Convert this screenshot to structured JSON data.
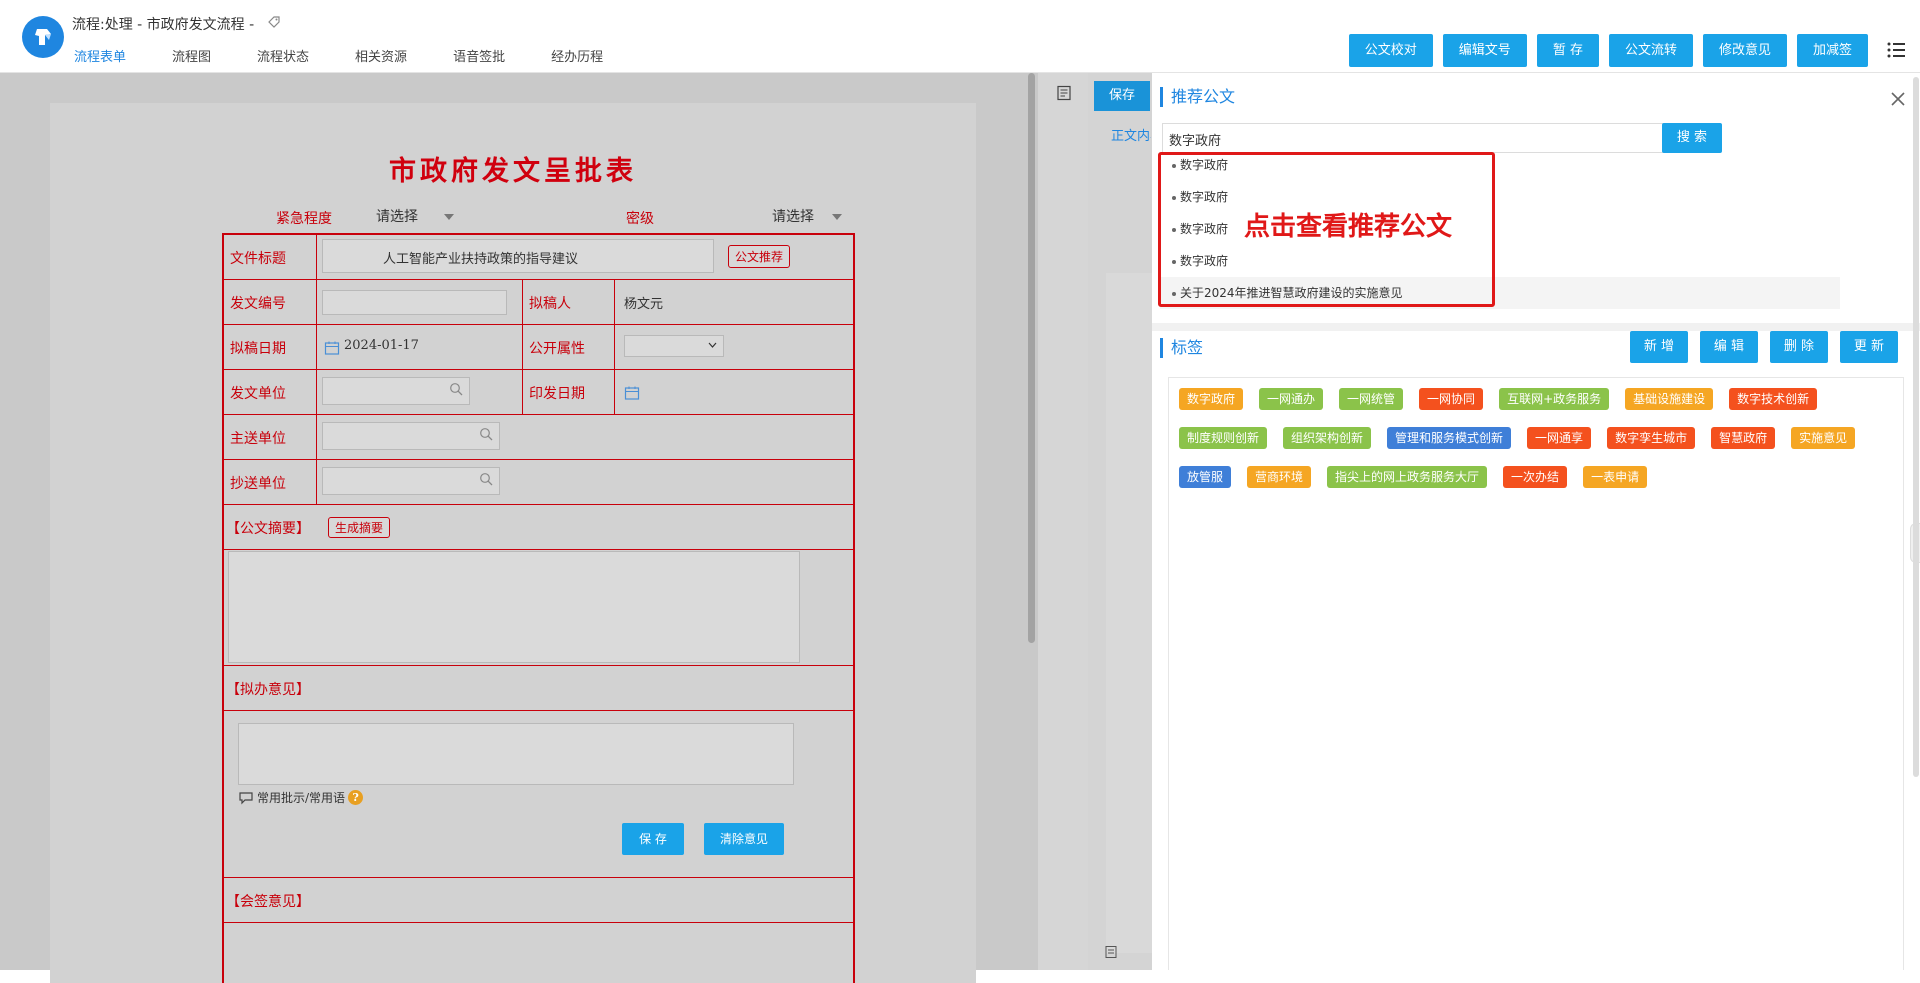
{
  "header": {
    "title": "流程:处理 - 市政府发文流程 -",
    "nav_tabs": [
      "流程表单",
      "流程图",
      "流程状态",
      "相关资源",
      "语音签批",
      "经办历程"
    ],
    "actions": [
      "公文校对",
      "编辑文号",
      "暂 存",
      "公文流转",
      "修改意见",
      "加减签"
    ]
  },
  "form": {
    "title": "市政府发文呈批表",
    "urgency_label": "紧急程度",
    "urgency_value": "请选择",
    "secret_label": "密级",
    "secret_value": "请选择",
    "file_title_label": "文件标题",
    "file_title_value": "人工智能产业扶持政策的指导建议",
    "recommend_button": "公文推荐",
    "doc_number_label": "发文编号",
    "drafter_label": "拟稿人",
    "drafter_value": "杨文元",
    "draft_date_label": "拟稿日期",
    "draft_date_value": "2024-01-17",
    "public_label": "公开属性",
    "issue_unit_label": "发文单位",
    "print_date_label": "印发日期",
    "main_to_label": "主送单位",
    "copy_to_label": "抄送单位",
    "summary_label": "【公文摘要】",
    "summary_button": "生成摘要",
    "opinion_label": "【拟办意见】",
    "common_phrase": "常用批示/常用语",
    "save_button": "保 存",
    "clear_button": "清除意见",
    "countersign_label": "【会签意见】"
  },
  "middle": {
    "save": "保存",
    "tab": "正文内容"
  },
  "panel": {
    "recommend_title": "推荐公文",
    "search_value": "数字政府",
    "search_button": "搜 索",
    "results": [
      "数字政府",
      "数字政府",
      "数字政府",
      "数字政府",
      "关于2024年推进智慧政府建设的实施意见"
    ],
    "callout": "点击查看推荐公文",
    "tags_title": "标签",
    "tag_actions": [
      "新 增",
      "编 辑",
      "删 除",
      "更 新"
    ],
    "tags": [
      {
        "label": "数字政府",
        "color": "#f5a623"
      },
      {
        "label": "一网通办",
        "color": "#8bc34a"
      },
      {
        "label": "一网统管",
        "color": "#8bc34a"
      },
      {
        "label": "一网协同",
        "color": "#f4511e"
      },
      {
        "label": "互联网+政务服务",
        "color": "#8bc34a"
      },
      {
        "label": "基础设施建设",
        "color": "#f5a623"
      },
      {
        "label": "数字技术创新",
        "color": "#f4511e"
      },
      {
        "label": "制度规则创新",
        "color": "#8bc34a"
      },
      {
        "label": "组织架构创新",
        "color": "#8bc34a"
      },
      {
        "label": "管理和服务模式创新",
        "color": "#3f7fd8"
      },
      {
        "label": "一网通享",
        "color": "#f4511e"
      },
      {
        "label": "数字孪生城市",
        "color": "#f4511e"
      },
      {
        "label": "智慧政府",
        "color": "#f4511e"
      },
      {
        "label": "实施意见",
        "color": "#f5a623"
      },
      {
        "label": "放管服",
        "color": "#3f7fd8"
      },
      {
        "label": "营商环境",
        "color": "#f5a623"
      },
      {
        "label": "指尖上的网上政务服务大厅",
        "color": "#8bc34a"
      },
      {
        "label": "一次办结",
        "color": "#f4511e"
      },
      {
        "label": "一表申请",
        "color": "#f5a623"
      }
    ]
  }
}
